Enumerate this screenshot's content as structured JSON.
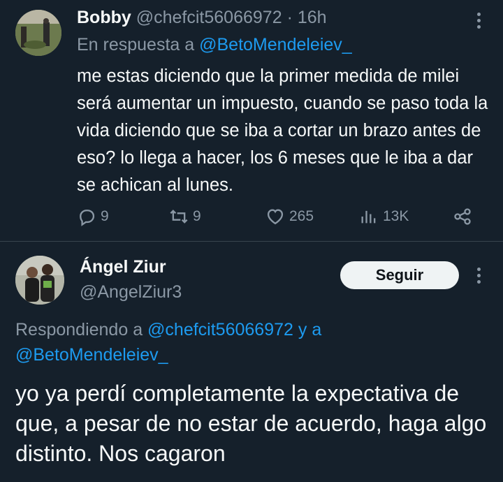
{
  "tweet1": {
    "display_name": "Bobby",
    "handle": "@chefcit56066972",
    "separator": "·",
    "time": "16h",
    "reply_prefix": "En respuesta a",
    "reply_to": "@BetoMendeleiev_",
    "text": "me estas diciendo que la primer medida de milei será aumentar un impuesto, cuando se paso toda la vida diciendo que se iba a cortar un brazo antes de eso? lo llega a hacer, los 6 meses que le iba a dar se achican al lunes.",
    "replies": "9",
    "retweets": "9",
    "likes": "265",
    "views": "13K"
  },
  "tweet2": {
    "display_name": "Ángel Ziur",
    "handle": "@AngelZiur3",
    "follow_label": "Seguir",
    "replying_prefix": "Respondiendo a",
    "replying_to_1": "@chefcit56066972",
    "replying_and": "y a",
    "replying_to_2": "@BetoMendeleiev_",
    "text": "yo ya perdí completamente la expectativa de que, a pesar de no estar de acuerdo, haga algo distinto. Nos cagaron"
  },
  "colors": {
    "background": "#15202b",
    "text": "#f7f9f9",
    "muted": "#8b98a5",
    "link": "#1d9bf0",
    "divider": "#38444d",
    "follow_button_bg": "#eff3f4"
  },
  "icons": [
    "reply-icon",
    "retweet-icon",
    "like-icon",
    "views-icon",
    "share-icon",
    "more-icon"
  ]
}
